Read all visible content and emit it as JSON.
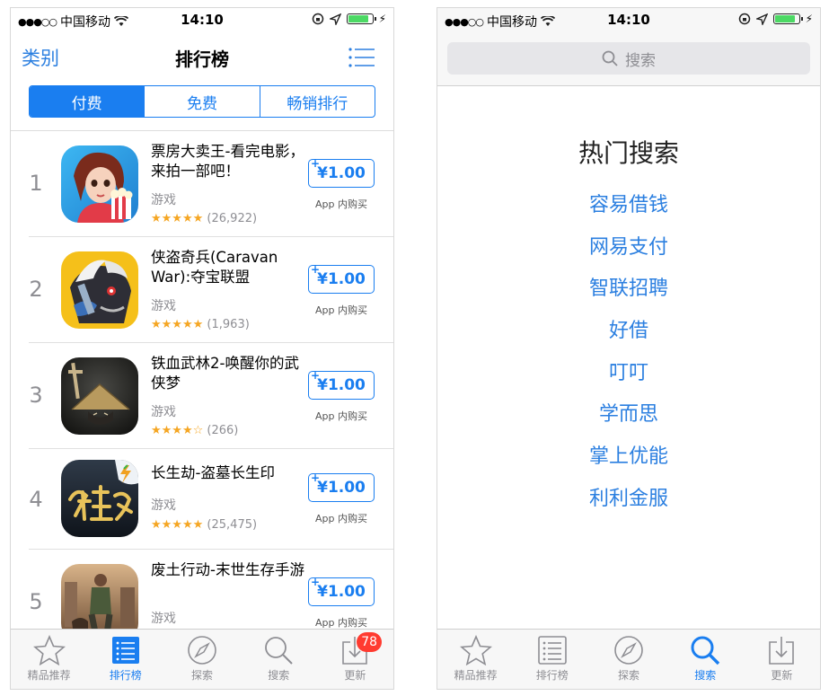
{
  "status_bar": {
    "carrier": "中国移动",
    "time": "14:10"
  },
  "left_screen": {
    "nav": {
      "back_label": "类别",
      "title": "排行榜"
    },
    "segments": [
      {
        "label": "付费",
        "active": true
      },
      {
        "label": "免费",
        "active": false
      },
      {
        "label": "畅销排行",
        "active": false
      }
    ],
    "apps": [
      {
        "rank": "1",
        "name": "票房大卖王-看完电影，来拍一部吧！",
        "category": "游戏",
        "stars": "★★★★★",
        "rating_count": "(26,922)",
        "price": "¥1.00",
        "iap": "App 内购买",
        "icon": "cinema-girl-icon"
      },
      {
        "rank": "2",
        "name": "侠盗奇兵(Caravan War):夺宝联盟",
        "category": "游戏",
        "stars": "★★★★★",
        "rating_count": "(1,963)",
        "price": "¥1.00",
        "iap": "App 内购买",
        "icon": "war-beast-icon"
      },
      {
        "rank": "3",
        "name": "铁血武林2-唤醒你的武侠梦",
        "category": "游戏",
        "stars": "★★★★☆",
        "rating_count": "(266)",
        "price": "¥1.00",
        "iap": "App 内购买",
        "icon": "swordsman-hat-icon"
      },
      {
        "rank": "4",
        "name": "长生劫-盗墓长生印",
        "category": "游戏",
        "stars": "★★★★★",
        "rating_count": "(25,475)",
        "price": "¥1.00",
        "iap": "App 内购买",
        "icon": "calligraphy-logo-icon"
      },
      {
        "rank": "5",
        "name": "废土行动-末世生存手游",
        "category": "游戏",
        "stars": "",
        "rating_count": "",
        "price": "¥1.00",
        "iap": "App 内购买",
        "icon": "wasteland-soldier-icon"
      }
    ],
    "tabs": [
      {
        "label": "精品推荐",
        "icon": "star-icon",
        "active": false
      },
      {
        "label": "排行榜",
        "icon": "ranking-list-icon",
        "active": true
      },
      {
        "label": "探索",
        "icon": "compass-icon",
        "active": false
      },
      {
        "label": "搜索",
        "icon": "search-icon",
        "active": false
      },
      {
        "label": "更新",
        "icon": "download-icon",
        "active": false,
        "badge": "78"
      }
    ]
  },
  "right_screen": {
    "search_placeholder": "搜索",
    "hot_title": "热门搜索",
    "hot_items": [
      "容易借钱",
      "网易支付",
      "智联招聘",
      "好借",
      "叮叮",
      "学而思",
      "掌上优能",
      "利利金服"
    ],
    "tabs": [
      {
        "label": "精品推荐",
        "icon": "star-icon",
        "active": false
      },
      {
        "label": "排行榜",
        "icon": "ranking-list-icon",
        "active": false
      },
      {
        "label": "探索",
        "icon": "compass-icon",
        "active": false
      },
      {
        "label": "搜索",
        "icon": "search-icon",
        "active": true
      },
      {
        "label": "更新",
        "icon": "download-icon",
        "active": false
      }
    ]
  },
  "colors": {
    "accent": "#1a7ef0",
    "link": "#2b7fe0",
    "star": "#f5a623",
    "badge": "#ff3b30",
    "battery": "#4cd964"
  }
}
